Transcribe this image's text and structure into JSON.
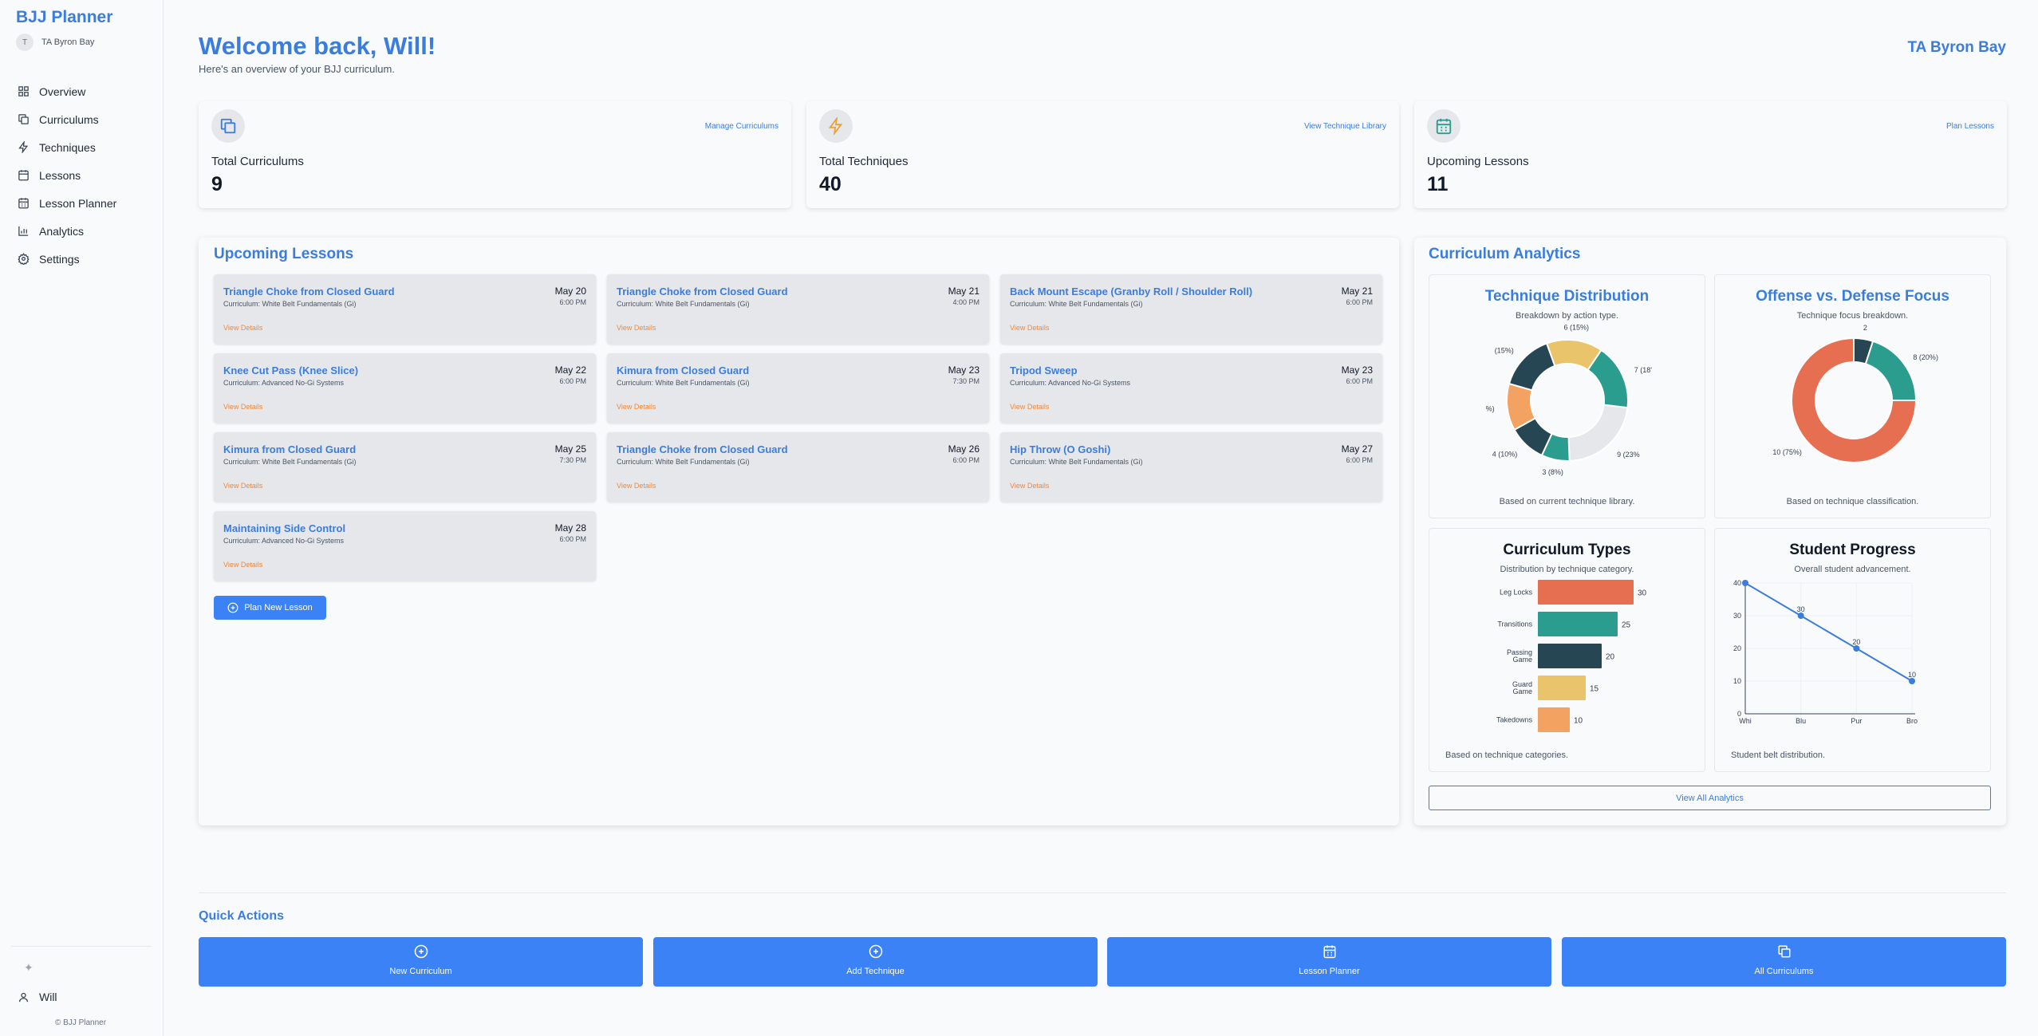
{
  "app": {
    "brand": "BJJ Planner",
    "org_initial": "T",
    "org_name": "TA Byron Bay"
  },
  "nav": [
    {
      "label": "Overview",
      "icon": "grid-icon"
    },
    {
      "label": "Curriculums",
      "icon": "copy-icon"
    },
    {
      "label": "Techniques",
      "icon": "bolt-icon"
    },
    {
      "label": "Lessons",
      "icon": "calendar-icon"
    },
    {
      "label": "Lesson Planner",
      "icon": "calendar-grid-icon"
    },
    {
      "label": "Analytics",
      "icon": "bar-chart-icon"
    },
    {
      "label": "Settings",
      "icon": "gear-icon"
    }
  ],
  "user": {
    "name": "Will",
    "copyright": "© BJJ Planner"
  },
  "header": {
    "welcome": "Welcome back, Will!",
    "subtitle": "Here's an overview of your BJJ curriculum.",
    "location": "TA Byron Bay"
  },
  "stats": [
    {
      "label": "Total Curriculums",
      "value": "9",
      "link": "Manage Curriculums",
      "icon": "copy-icon"
    },
    {
      "label": "Total Techniques",
      "value": "40",
      "link": "View Technique Library",
      "icon": "bolt-icon"
    },
    {
      "label": "Upcoming Lessons",
      "value": "11",
      "link": "Plan Lessons",
      "icon": "calendar-grid-icon"
    }
  ],
  "lessons_panel": {
    "title": "Upcoming Lessons",
    "view_label": "View Details",
    "plan_button": "Plan New Lesson",
    "items": [
      {
        "title": "Triangle Choke from Closed Guard",
        "curriculum": "Curriculum: White Belt Fundamentals (Gi)",
        "date": "May 20",
        "time": "6:00 PM"
      },
      {
        "title": "Triangle Choke from Closed Guard",
        "curriculum": "Curriculum: White Belt Fundamentals (Gi)",
        "date": "May 21",
        "time": "4:00 PM"
      },
      {
        "title": "Back Mount Escape (Granby Roll / Shoulder Roll)",
        "curriculum": "Curriculum: White Belt Fundamentals (Gi)",
        "date": "May 21",
        "time": "6:00 PM"
      },
      {
        "title": "Knee Cut Pass (Knee Slice)",
        "curriculum": "Curriculum: Advanced No-Gi Systems",
        "date": "May 22",
        "time": "6:00 PM"
      },
      {
        "title": "Kimura from Closed Guard",
        "curriculum": "Curriculum: White Belt Fundamentals (Gi)",
        "date": "May 23",
        "time": "7:30 PM"
      },
      {
        "title": "Tripod Sweep",
        "curriculum": "Curriculum: Advanced No-Gi Systems",
        "date": "May 23",
        "time": "6:00 PM"
      },
      {
        "title": "Kimura from Closed Guard",
        "curriculum": "Curriculum: White Belt Fundamentals (Gi)",
        "date": "May 25",
        "time": "7:30 PM"
      },
      {
        "title": "Triangle Choke from Closed Guard",
        "curriculum": "Curriculum: White Belt Fundamentals (Gi)",
        "date": "May 26",
        "time": "6:00 PM"
      },
      {
        "title": "Hip Throw (O Goshi)",
        "curriculum": "Curriculum: White Belt Fundamentals (Gi)",
        "date": "May 27",
        "time": "6:00 PM"
      },
      {
        "title": "Maintaining Side Control",
        "curriculum": "Curriculum: Advanced No-Gi Systems",
        "date": "May 28",
        "time": "6:00 PM"
      }
    ]
  },
  "analytics": {
    "title": "Curriculum Analytics",
    "view_all": "View All Analytics",
    "cards": [
      {
        "title": "Technique Distribution",
        "subtitle": "Breakdown by action type.",
        "footer": "Based on current technique library."
      },
      {
        "title": "Offense vs. Defense Focus",
        "subtitle": "Technique focus breakdown.",
        "footer": "Based on technique classification."
      },
      {
        "title": "Curriculum Types",
        "subtitle": "Distribution by technique category.",
        "footer": "Based on technique categories."
      },
      {
        "title": "Student Progress",
        "subtitle": "Overall student advancement.",
        "footer": "Student belt distribution."
      }
    ]
  },
  "chart_data": [
    {
      "type": "pie",
      "title": "Technique Distribution",
      "slices": [
        {
          "value": 6,
          "label": "6 (15%)",
          "color": "#e9c46a"
        },
        {
          "value": 7,
          "label": "7 (18'",
          "color": "#2a9d8f"
        },
        {
          "value": 9,
          "label": "9 (23%",
          "color": "#e5e7eb"
        },
        {
          "value": 3,
          "label": "3 (8%)",
          "color": "#2a9d8f"
        },
        {
          "value": 4,
          "label": "4 (10%)",
          "color": "#264653"
        },
        {
          "value": 5,
          "label": "%)",
          "color": "#f4a261"
        },
        {
          "value": 6,
          "label": "(15%)",
          "color": "#264653"
        }
      ]
    },
    {
      "type": "pie",
      "title": "Offense vs. Defense Focus",
      "slices": [
        {
          "value": 30,
          "label": "10 (75%)",
          "color": "#e76f51"
        },
        {
          "value": 2,
          "label": "2",
          "color": "#264653"
        },
        {
          "value": 8,
          "label": "8 (20%)",
          "color": "#2a9d8f"
        }
      ]
    },
    {
      "type": "bar",
      "orientation": "horizontal",
      "title": "Curriculum Types",
      "categories": [
        "Leg Locks",
        "Transitions",
        "Passing Game",
        "Guard Game",
        "Takedowns"
      ],
      "category_lines": [
        [
          "Leg Locks"
        ],
        [
          "Transitions"
        ],
        [
          "Passing",
          "Game"
        ],
        [
          "Guard",
          "Game"
        ],
        [
          "Takedowns"
        ]
      ],
      "values": [
        30,
        25,
        20,
        15,
        10
      ],
      "colors": [
        "#e76f51",
        "#2a9d8f",
        "#264653",
        "#e9c46a",
        "#f4a261"
      ],
      "xlim": [
        0,
        30
      ]
    },
    {
      "type": "line",
      "title": "Student Progress",
      "categories": [
        "Whi",
        "Blu",
        "Pur",
        "Bro"
      ],
      "values": [
        40,
        30,
        20,
        10
      ],
      "point_labels": [
        "",
        "30",
        "20",
        "10"
      ],
      "ylim": [
        0,
        40
      ],
      "yticks": [
        "0",
        "10",
        "20",
        "30",
        "40"
      ],
      "color": "#3b7ddd"
    }
  ],
  "quick_actions": {
    "title": "Quick Actions",
    "items": [
      {
        "label": "New Curriculum",
        "icon": "plus-circle-icon"
      },
      {
        "label": "Add Technique",
        "icon": "plus-circle-icon"
      },
      {
        "label": "Lesson Planner",
        "icon": "calendar-grid-icon"
      },
      {
        "label": "All Curriculums",
        "icon": "copy-icon"
      }
    ]
  }
}
